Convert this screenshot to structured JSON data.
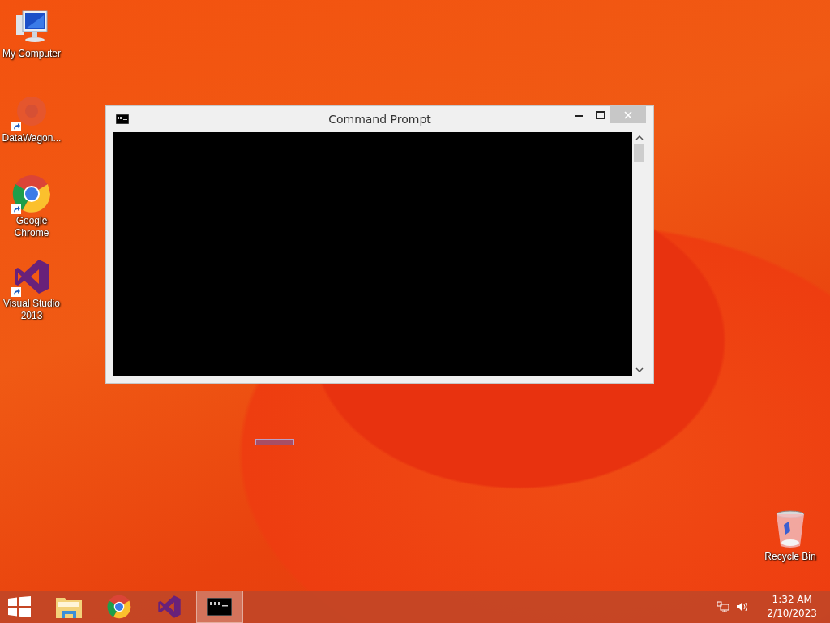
{
  "desktop_icons": [
    {
      "label": "My Computer",
      "kind": "computer",
      "shortcut": false
    },
    {
      "label": "DataWagon...",
      "kind": "faint",
      "shortcut": true
    },
    {
      "label": "Google Chrome",
      "kind": "chrome",
      "shortcut": true
    },
    {
      "label": "Visual Studio 2013",
      "kind": "vs",
      "shortcut": true
    },
    {
      "label": "Recycle Bin",
      "kind": "bin",
      "shortcut": false
    }
  ],
  "window": {
    "title": "Command Prompt"
  },
  "taskbar": {
    "items": [
      {
        "kind": "start",
        "selected": false
      },
      {
        "kind": "explorer",
        "selected": false
      },
      {
        "kind": "chrome",
        "selected": false
      },
      {
        "kind": "vs",
        "selected": false
      },
      {
        "kind": "console",
        "selected": true
      }
    ],
    "clock": {
      "time": "1:32 AM",
      "date": "2/10/2023"
    }
  }
}
